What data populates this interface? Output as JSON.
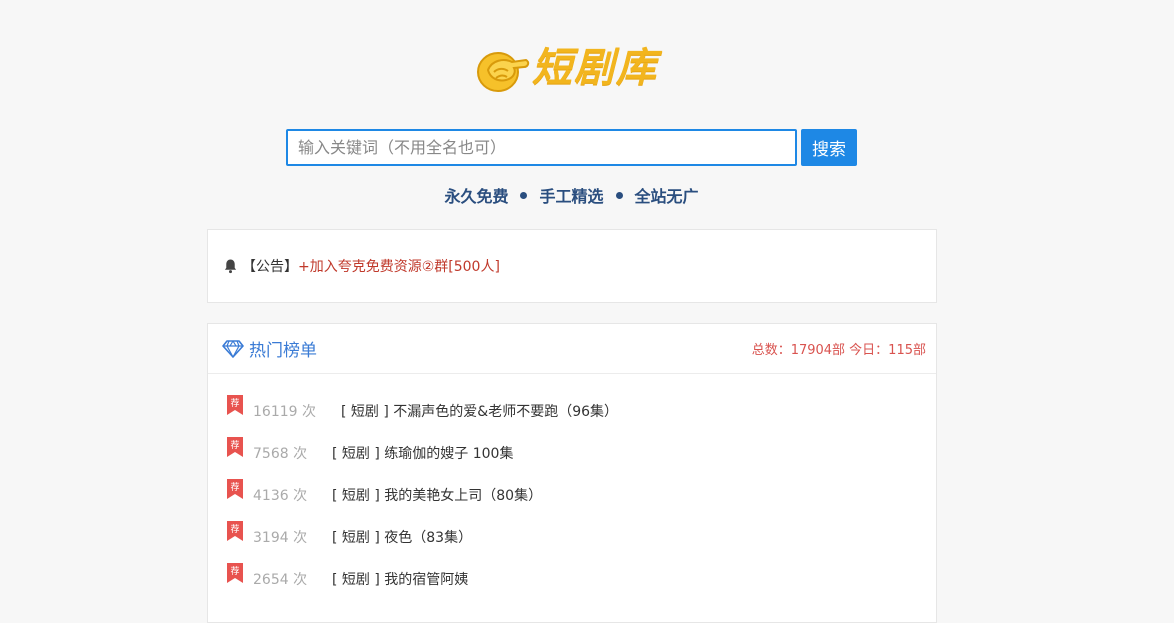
{
  "logo": {
    "text": "短剧库"
  },
  "search": {
    "placeholder": "输入关键词（不用全名也可）",
    "button_label": "搜索"
  },
  "slogan": {
    "items": [
      "永久免费",
      "手工精选",
      "全站无广"
    ]
  },
  "notice": {
    "prefix": "【公告】",
    "link_text": "+加入夸克免费资源②群[500人]"
  },
  "hot": {
    "title": "热门榜单",
    "stats": "总数：17904部 今日：115部",
    "badge_char": "荐",
    "items": [
      {
        "count": "16119 次",
        "title": "[ 短剧 ] 不漏声色的爱&老师不要跑（96集）"
      },
      {
        "count": "7568 次",
        "title": "[ 短剧 ] 练瑜伽的嫂子 100集"
      },
      {
        "count": "4136 次",
        "title": "[ 短剧 ] 我的美艳女上司（80集）"
      },
      {
        "count": "3194 次",
        "title": "[ 短剧 ] 夜色（83集）"
      },
      {
        "count": "2654 次",
        "title": "[ 短剧 ] 我的宿管阿姨"
      }
    ]
  },
  "colors": {
    "accent": "#1e88e5",
    "logo": "#f2b51e",
    "slogan": "#2a4e7f",
    "stats": "#d9534f",
    "badge": "#e8534f"
  }
}
